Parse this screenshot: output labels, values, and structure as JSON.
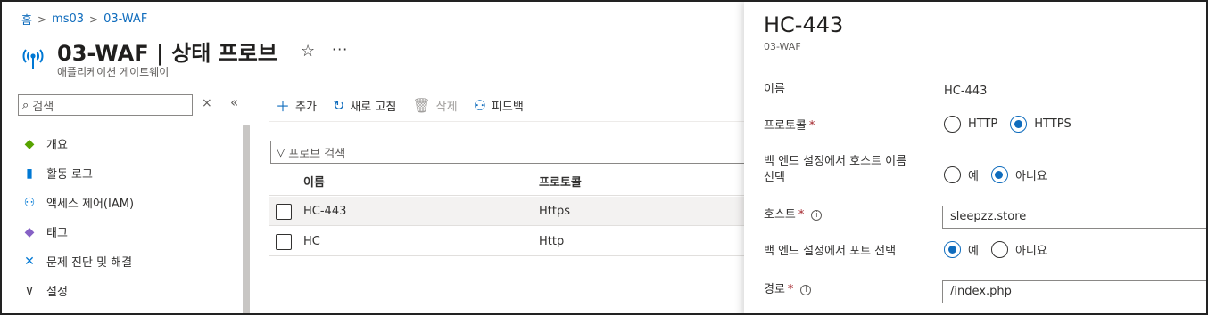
{
  "breadcrumb": {
    "home": "홈",
    "item1": "ms03",
    "item2": "03-WAF",
    "separator": ">"
  },
  "header": {
    "title": "03-WAF | 상태 프로브",
    "subtitle": "애플리케이션 게이트웨이",
    "star_icon": "☆",
    "more_icon": "···"
  },
  "nav": {
    "search_placeholder": "검색",
    "close_glyph": "×",
    "collapse_glyph": "«",
    "items": [
      {
        "label": "개요",
        "icon": "overview-icon",
        "glyph": "◆",
        "color": "#57a300"
      },
      {
        "label": "활동 로그",
        "icon": "activity-log-icon",
        "glyph": "▮",
        "color": "#0078d4"
      },
      {
        "label": "액세스 제어(IAM)",
        "icon": "iam-icon",
        "glyph": "⚇",
        "color": "#0078d4"
      },
      {
        "label": "태그",
        "icon": "tag-icon",
        "glyph": "◆",
        "color": "#8661c5"
      },
      {
        "label": "문제 진단 및 해결",
        "icon": "diagnose-icon",
        "glyph": "✕",
        "color": "#0078d4"
      },
      {
        "label": "설정",
        "icon": "chevron-down-icon",
        "glyph": "∨",
        "color": "#323130"
      }
    ]
  },
  "toolbar": {
    "add": "추가",
    "refresh": "새로 고침",
    "delete": "삭제",
    "feedback": "피드백"
  },
  "filter": {
    "placeholder": "프로브 검색"
  },
  "table": {
    "columns": [
      "이름",
      "프로토콜"
    ],
    "rows": [
      {
        "name": "HC-443",
        "protocol": "Https",
        "selected": true
      },
      {
        "name": "HC",
        "protocol": "Http",
        "selected": false
      }
    ]
  },
  "panel": {
    "title": "HC-443",
    "subtitle": "03-WAF",
    "name_label": "이름",
    "name_value": "HC-443",
    "protocol_label": "프로토콜",
    "protocol_options": [
      "HTTP",
      "HTTPS"
    ],
    "protocol_selected": "HTTPS",
    "pick_host_label_line1": "백 엔드 설정에서 호스트 이름",
    "pick_host_label_line2": "선택",
    "pick_host_options": [
      "예",
      "아니요"
    ],
    "pick_host_selected": "아니요",
    "host_label": "호스트",
    "host_value": "sleepzz.store",
    "pick_port_label": "백 엔드 설정에서 포트 선택",
    "pick_port_options": [
      "예",
      "아니요"
    ],
    "pick_port_selected": "예",
    "path_label": "경로",
    "path_value": "/index.php",
    "required_mark": "*",
    "info_glyph": "i"
  }
}
